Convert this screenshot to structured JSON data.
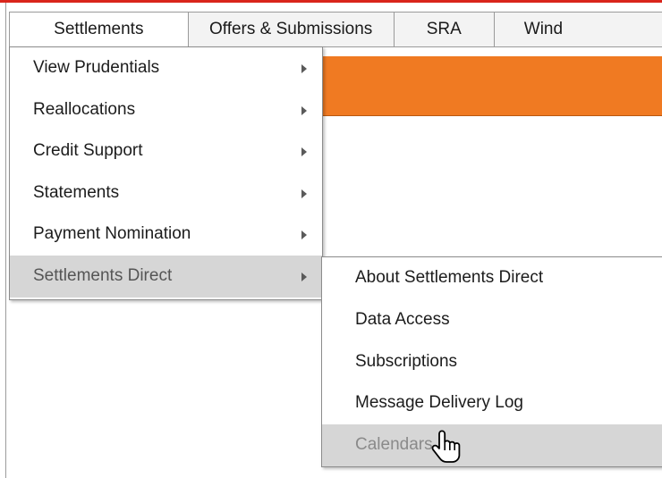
{
  "menubar": {
    "items": [
      {
        "label": "Settlements",
        "active": true
      },
      {
        "label": "Offers & Submissions",
        "active": false
      },
      {
        "label": "SRA",
        "active": false
      },
      {
        "label": "Wind",
        "active": false
      }
    ]
  },
  "settlements_menu": {
    "items": [
      {
        "label": "View Prudentials",
        "has_submenu": true
      },
      {
        "label": "Reallocations",
        "has_submenu": true
      },
      {
        "label": "Credit Support",
        "has_submenu": true
      },
      {
        "label": "Statements",
        "has_submenu": true
      },
      {
        "label": "Payment Nomination",
        "has_submenu": true
      },
      {
        "label": "Settlements Direct",
        "has_submenu": true,
        "highlighted": true
      }
    ]
  },
  "settlements_direct_submenu": {
    "items": [
      {
        "label": "About Settlements Direct"
      },
      {
        "label": "Data Access"
      },
      {
        "label": "Subscriptions"
      },
      {
        "label": "Message Delivery Log"
      },
      {
        "label": "Calendars",
        "highlighted": true
      }
    ]
  },
  "theme": {
    "accent_orange": "#f07a22",
    "top_line_red": "#d9251c",
    "highlight_gray": "#d6d6d6"
  },
  "cursor": {
    "icon": "hand-pointer-icon"
  }
}
